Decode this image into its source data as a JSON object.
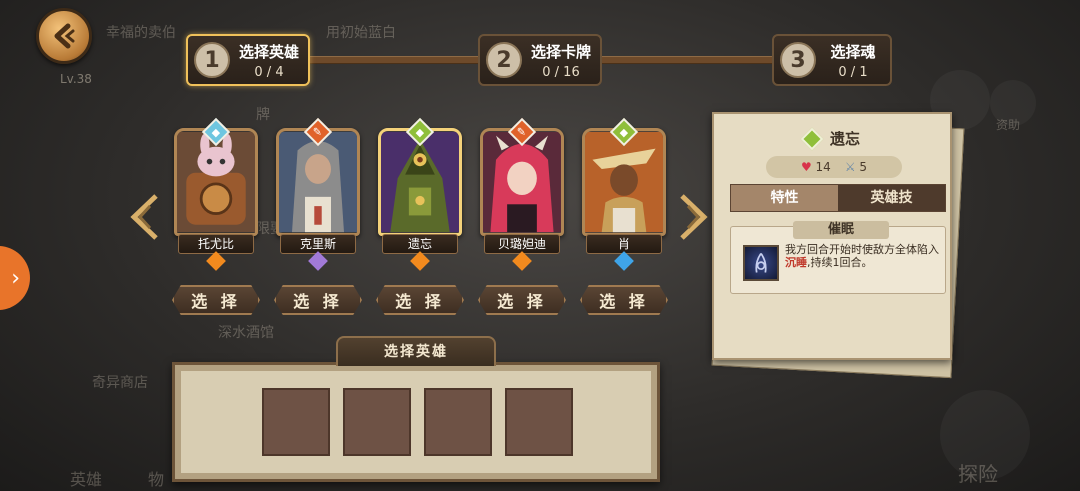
{
  "background": {
    "labels": [
      "幸福的卖伯",
      "用初始蓝白",
      "深水酒馆",
      "奇异商店",
      "英雄",
      "物",
      "探险",
      "限要",
      "资助",
      "牌"
    ]
  },
  "header": {
    "level_label": "Lv.38"
  },
  "steps": [
    {
      "num": "1",
      "title": "选择英雄",
      "count": "0 / 4"
    },
    {
      "num": "2",
      "title": "选择卡牌",
      "count": "0 / 16"
    },
    {
      "num": "3",
      "title": "选择魂",
      "count": "0 / 1"
    }
  ],
  "heroes": [
    {
      "name": "托尤比",
      "select_label": "选 择",
      "gem": "◆"
    },
    {
      "name": "克里斯",
      "select_label": "选 择",
      "gem": "✎"
    },
    {
      "name": "遗忘",
      "select_label": "选 择",
      "gem": "◆"
    },
    {
      "name": "贝璐妲迪",
      "select_label": "选 择",
      "gem": "✎"
    },
    {
      "name": "肖",
      "select_label": "选 择",
      "gem": "◆"
    }
  ],
  "detail": {
    "name": "遗忘",
    "hp": "14",
    "power": "5",
    "tab_trait": "特性",
    "tab_skill": "英雄技",
    "skill_name": "催眠",
    "skill_desc_a": "我方回合开始时使敌方全体陷入",
    "skill_desc_hl": "沉睡",
    "skill_desc_b": ",持续1回合。"
  },
  "selection": {
    "title": "选择英雄"
  },
  "colors": {
    "accent_gold": "#f0c15a",
    "gem_green": "#8fbf3a",
    "gem_blue": "#6ec6e0",
    "gem_orange": "#e0622a",
    "rarity_orange": "#f28a1e",
    "rarity_purple": "#a27ad8",
    "rarity_blue": "#3fa4e8",
    "highlight_red": "#c0392b"
  }
}
